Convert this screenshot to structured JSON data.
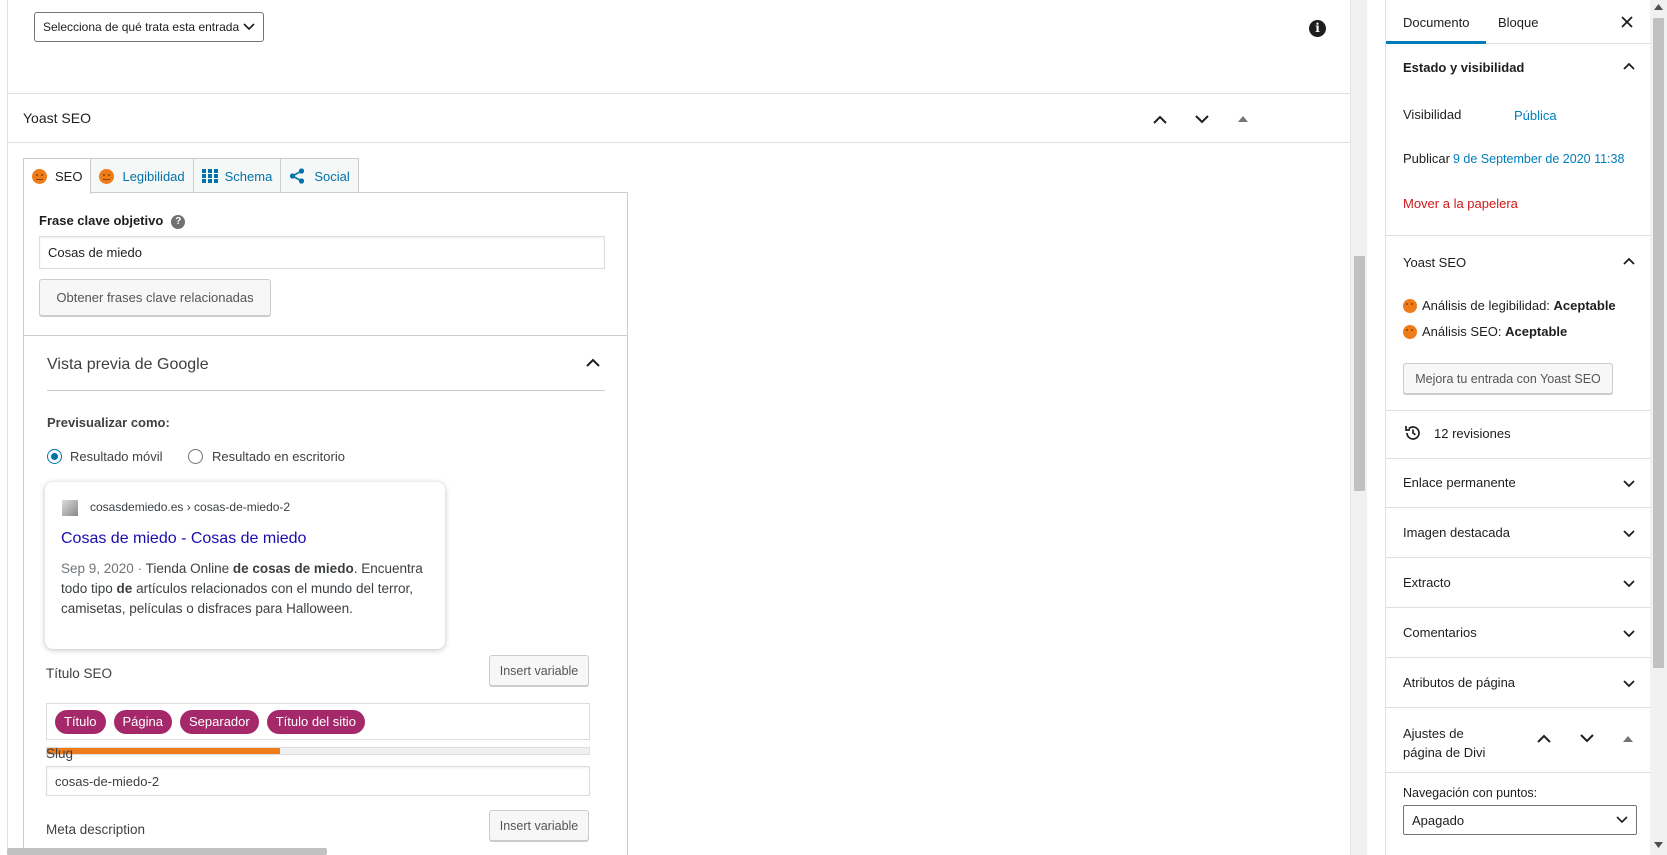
{
  "editor": {
    "format_select": "Selecciona de qué trata esta entrada",
    "metabox_title": "Yoast SEO"
  },
  "yoast": {
    "tabs": [
      {
        "label": "SEO"
      },
      {
        "label": "Legibilidad"
      },
      {
        "label": "Schema"
      },
      {
        "label": "Social"
      }
    ],
    "focus_keyphrase_label": "Frase clave objetivo",
    "focus_keyphrase_help": "?",
    "focus_keyphrase_value": "Cosas de miedo",
    "related_button": "Obtener frases clave relacionadas",
    "google_preview_title": "Vista previa de Google",
    "preview_as_label": "Previsualizar como:",
    "radio_mobile": "Resultado móvil",
    "radio_desktop": "Resultado en escritorio",
    "snippet": {
      "url": "cosasdemiedo.es › cosas-de-miedo-2",
      "title": "Cosas de miedo - Cosas de miedo",
      "date": "Sep 9, 2020 · ",
      "desc_1": "Tienda Online ",
      "desc_bold_1": "de cosas de miedo",
      "desc_2": ". Encuentra todo tipo ",
      "desc_bold_2": "de",
      "desc_3": " artículos relacionados con el mundo del terror, camisetas, películas o disfraces para Halloween."
    },
    "seo_title_label": "Título SEO",
    "insert_variable": "Insert variable",
    "pills": [
      "Título",
      "Página",
      "Separador",
      "Título del sitio"
    ],
    "title_progress": 0.43,
    "progress_color": "#ee7c1b",
    "slug_label": "Slug",
    "slug_value": "cosas-de-miedo-2",
    "meta_description_label": "Meta description",
    "insert_variable_2": "Insert variable"
  },
  "sidebar": {
    "tab_document": "Documento",
    "tab_block": "Bloque",
    "close": "×",
    "status_title": "Estado y visibilidad",
    "visibility_label": "Visibilidad",
    "visibility_value": "Pública",
    "publish_label": "Publicar",
    "publish_value": "9 de September de 2020 11:38",
    "trash": "Mover a la papelera",
    "yoast_title": "Yoast SEO",
    "readability_label": "Análisis de legibilidad: ",
    "readability_value": "Aceptable",
    "seo_analysis_label": "Análisis SEO: ",
    "seo_analysis_value": "Aceptable",
    "improve_button": "Mejora tu entrada con Yoast SEO",
    "revisions": "12 revisiones",
    "panels": [
      "Enlace permanente",
      "Imagen destacada",
      "Extracto",
      "Comentarios",
      "Atributos de página"
    ],
    "divi_title_1": "Ajustes de",
    "divi_title_2": "página de Divi",
    "dot_nav_label": "Navegación con puntos:",
    "dot_nav_value": "Apagado"
  }
}
